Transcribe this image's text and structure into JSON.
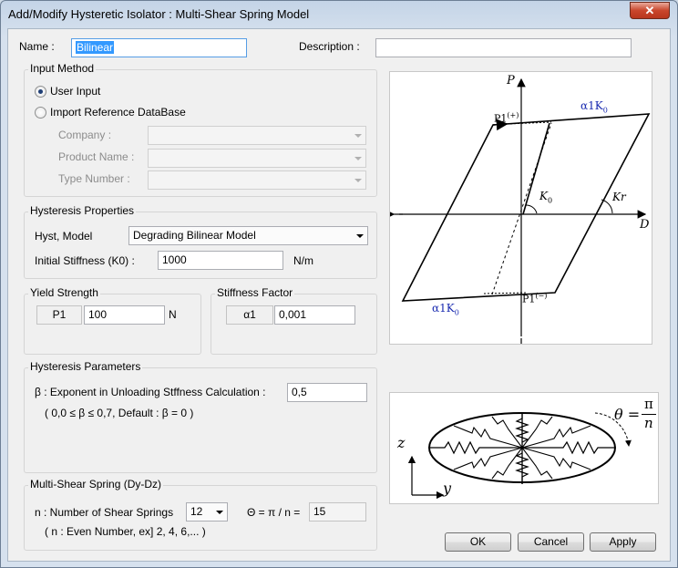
{
  "window": {
    "title": "Add/Modify Hysteretic Isolator : Multi-Shear Spring Model",
    "close_glyph": "✕"
  },
  "name": {
    "label": "Name :",
    "value": "Bilinear"
  },
  "description": {
    "label": "Description :",
    "value": ""
  },
  "input_method": {
    "title": "Input Method",
    "user_input": "User Input",
    "import_ref": "Import Reference DataBase",
    "selected": "User Input",
    "company_label": "Company :",
    "product_label": "Product Name :",
    "type_label": "Type Number :"
  },
  "hysteresis_properties": {
    "title": "Hysteresis Properties",
    "model_label": "Hyst, Model",
    "model_value": "Degrading Bilinear Model",
    "k0_label": "Initial Stiffness (K0) :",
    "k0_value": "1000",
    "k0_unit": "N/m"
  },
  "yield_strength": {
    "title": "Yield Strength",
    "p1_label": "P1",
    "p1_value": "100",
    "unit": "N"
  },
  "stiffness_factor": {
    "title": "Stiffness Factor",
    "a1_label": "α1",
    "a1_value": "0,001"
  },
  "hysteresis_parameters": {
    "title": "Hysteresis Parameters",
    "beta_label": "β : Exponent in Unloading Stffness Calculation :",
    "beta_value": "0,5",
    "beta_note": "( 0,0 ≤ β ≤ 0,7, Default : β = 0 )"
  },
  "multi_shear": {
    "title": "Multi-Shear Spring (Dy-Dz)",
    "n_label": "n : Number of Shear Springs",
    "n_value": "12",
    "theta_label": "Θ = π / n =",
    "theta_value": "15",
    "n_note": "( n : Even Number, ex] 2, 4, 6,... )"
  },
  "diagram": {
    "p_axis": "P",
    "d_axis": "D",
    "p1_plus": "P1",
    "p1_plus_sup": "(+)",
    "p1_minus": "P1",
    "p1_minus_sup": "(−)",
    "alpha_top": "α1K",
    "alpha_top_sub": "0",
    "alpha_bottom": "α1K",
    "alpha_bottom_sub": "0",
    "k0": "K",
    "k0_sub": "0",
    "kr": "Kr"
  },
  "spring_diagram": {
    "z_axis": "z",
    "y_axis": "y",
    "theta": "θ =",
    "pi": "π",
    "n": "n"
  },
  "buttons": {
    "ok": "OK",
    "cancel": "Cancel",
    "apply": "Apply"
  },
  "colors": {
    "accent_blue": "#3399ff",
    "diagram_label_blue": "#1a2bb0",
    "close_red": "#c9462c"
  }
}
